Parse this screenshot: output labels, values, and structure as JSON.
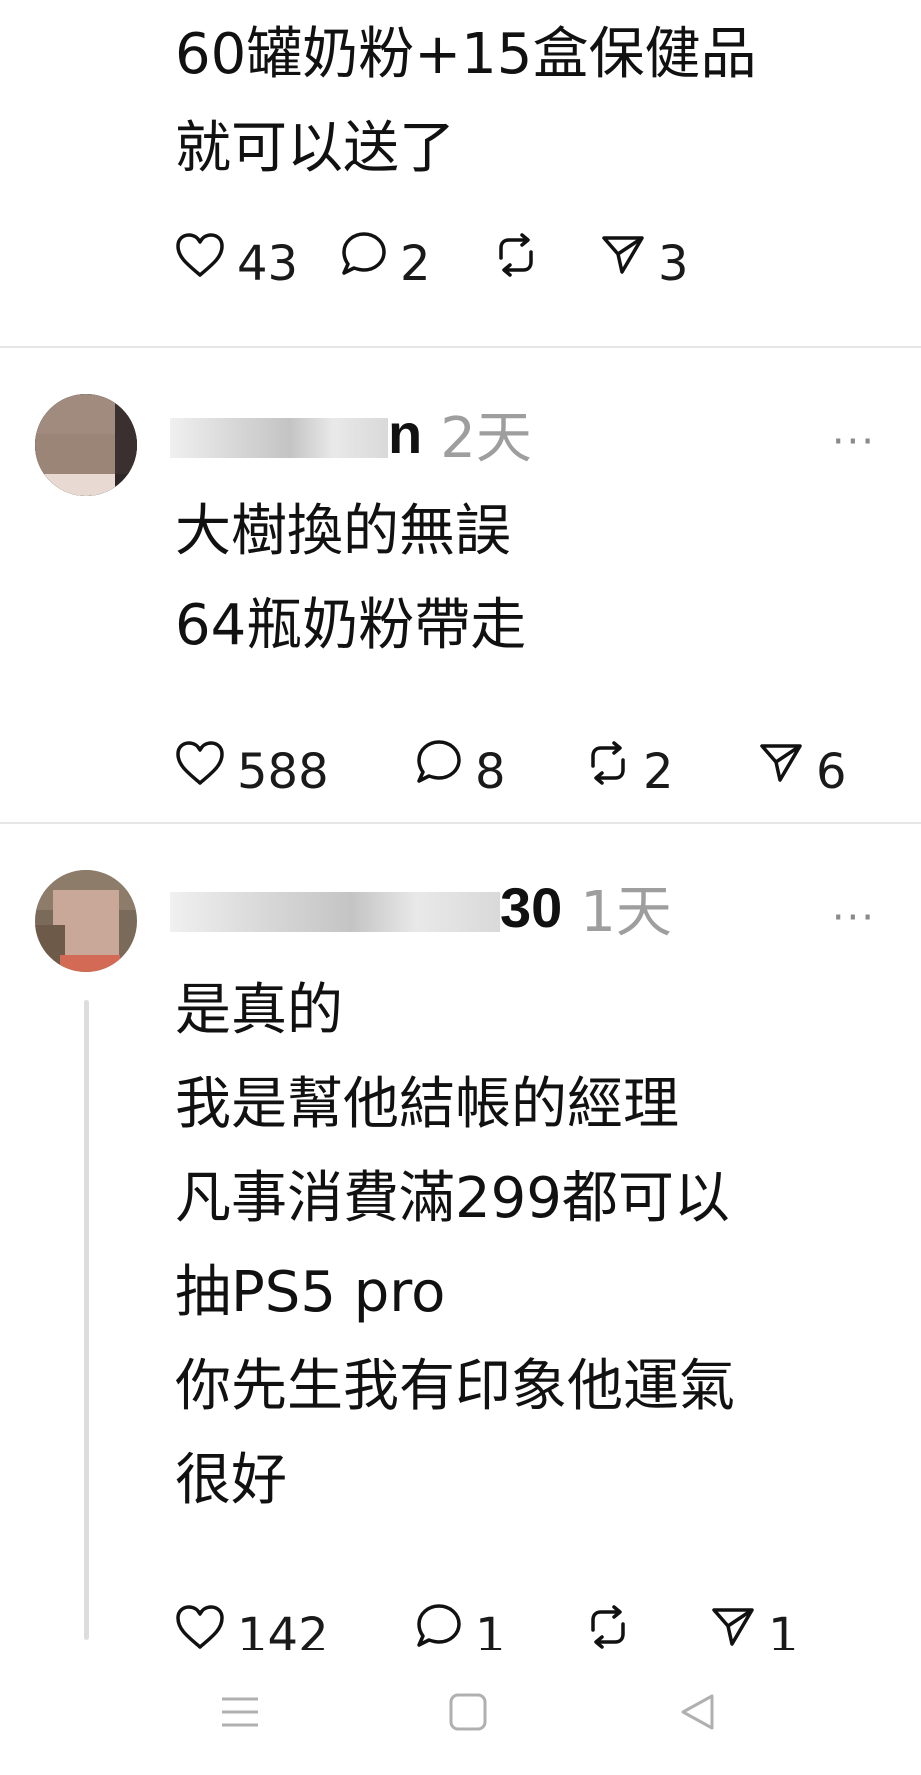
{
  "posts": [
    {
      "username_visible": "",
      "timestamp": "",
      "lines": [
        "60罐奶粉+15盒保健品",
        "就可以送了"
      ],
      "likes": "43",
      "comments": "2",
      "reposts": "",
      "shares": "3"
    },
    {
      "username_visible": "n",
      "timestamp": "2天",
      "lines": [
        "大樹換的無誤",
        "64瓶奶粉帶走"
      ],
      "likes": "588",
      "comments": "8",
      "reposts": "2",
      "shares": "6"
    },
    {
      "username_visible": "30",
      "timestamp": "1天",
      "lines": [
        "是真的",
        "我是幫他結帳的經理",
        "凡事消費滿299都可以",
        "抽PS5 pro",
        "你先生我有印象他運氣",
        "很好"
      ],
      "likes": "142",
      "comments": "1",
      "reposts": "",
      "shares": "1"
    }
  ],
  "more_menu": "···",
  "icons": {
    "like": "heart-icon",
    "comment": "comment-bubble-icon",
    "repost": "repost-icon",
    "share": "send-icon",
    "nav_menu": "menu-icon",
    "nav_home": "square-home-icon",
    "nav_back": "triangle-back-icon"
  },
  "colors": {
    "text": "#111111",
    "muted": "#9e9e9e",
    "divider": "#e6e6e6",
    "nav_icon": "#b0b0b0"
  }
}
